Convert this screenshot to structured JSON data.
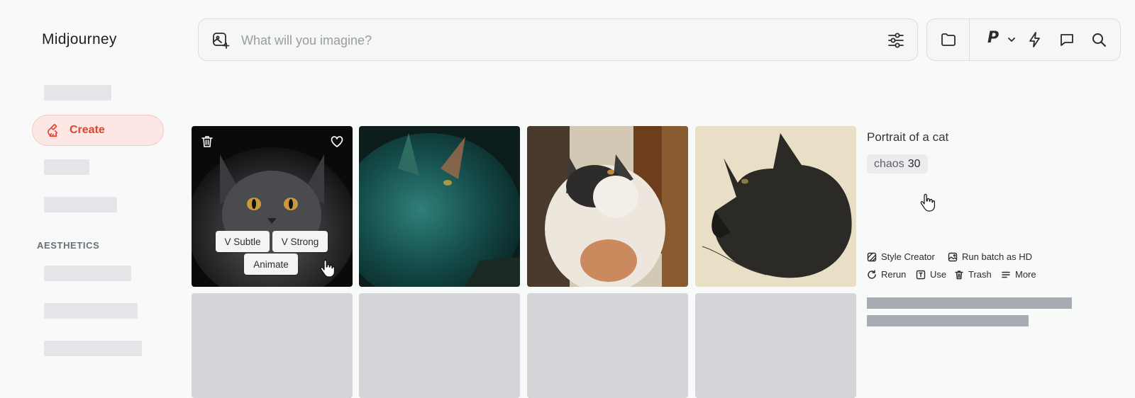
{
  "app": {
    "title": "Midjourney"
  },
  "sidebar": {
    "create_label": "Create",
    "aesthetics_label": "AESTHETICS"
  },
  "search": {
    "placeholder": "What will you imagine?",
    "value": ""
  },
  "toolbar": {
    "personalize_label": "P",
    "icons": [
      "folder-icon",
      "chevron-down-icon",
      "lightning-icon",
      "chat-icon",
      "search-icon"
    ]
  },
  "hover_actions": {
    "subtle": "V Subtle",
    "strong": "V Strong",
    "animate": "Animate"
  },
  "details": {
    "prompt": "Portrait of a cat",
    "param_name": "chaos",
    "param_value": "30",
    "actions": {
      "style_creator": "Style Creator",
      "run_batch_hd": "Run batch as HD",
      "rerun": "Rerun",
      "use": "Use",
      "trash": "Trash",
      "more": "More"
    }
  },
  "colors": {
    "accent": "#e2432e",
    "accent_bg": "#fde7e4",
    "placeholder": "#d4d5d8",
    "skeleton": "#e4e5e8"
  }
}
